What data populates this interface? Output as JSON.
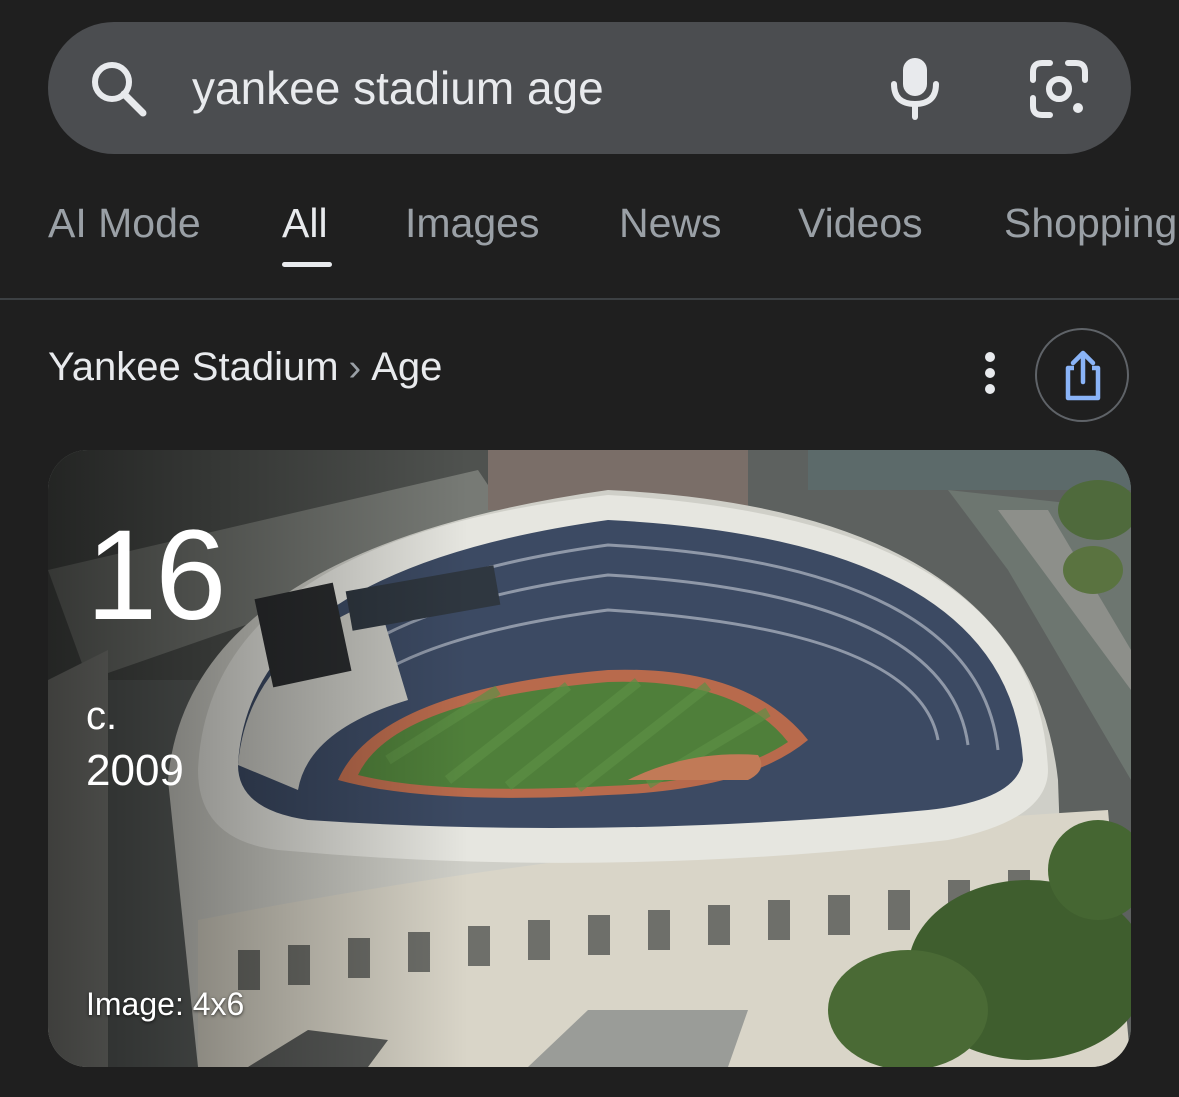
{
  "search": {
    "query": "yankee stadium age",
    "search_icon": "search-icon",
    "mic_icon": "mic-icon",
    "lens_icon": "camera-lens-icon"
  },
  "tabs": [
    {
      "label": "AI Mode",
      "active": false
    },
    {
      "label": "All",
      "active": true
    },
    {
      "label": "Images",
      "active": false
    },
    {
      "label": "News",
      "active": false
    },
    {
      "label": "Videos",
      "active": false
    },
    {
      "label": "Shopping",
      "active": false
    }
  ],
  "breadcrumb": {
    "entity": "Yankee Stadium",
    "separator": "›",
    "attribute": "Age"
  },
  "actions": {
    "more_icon": "more-vert-icon",
    "share_icon": "share-icon"
  },
  "answer_card": {
    "age_value": "16",
    "circa_label": "c.",
    "year": "2009",
    "image_caption": "Image: 4x6",
    "image_subject": "aerial photo of Yankee Stadium"
  },
  "colors": {
    "background": "#1f1f1f",
    "search_bar": "#4b4d50",
    "text_primary": "#e8eaed",
    "text_secondary": "#9aa0a6",
    "share_icon": "#8ab4f8"
  }
}
